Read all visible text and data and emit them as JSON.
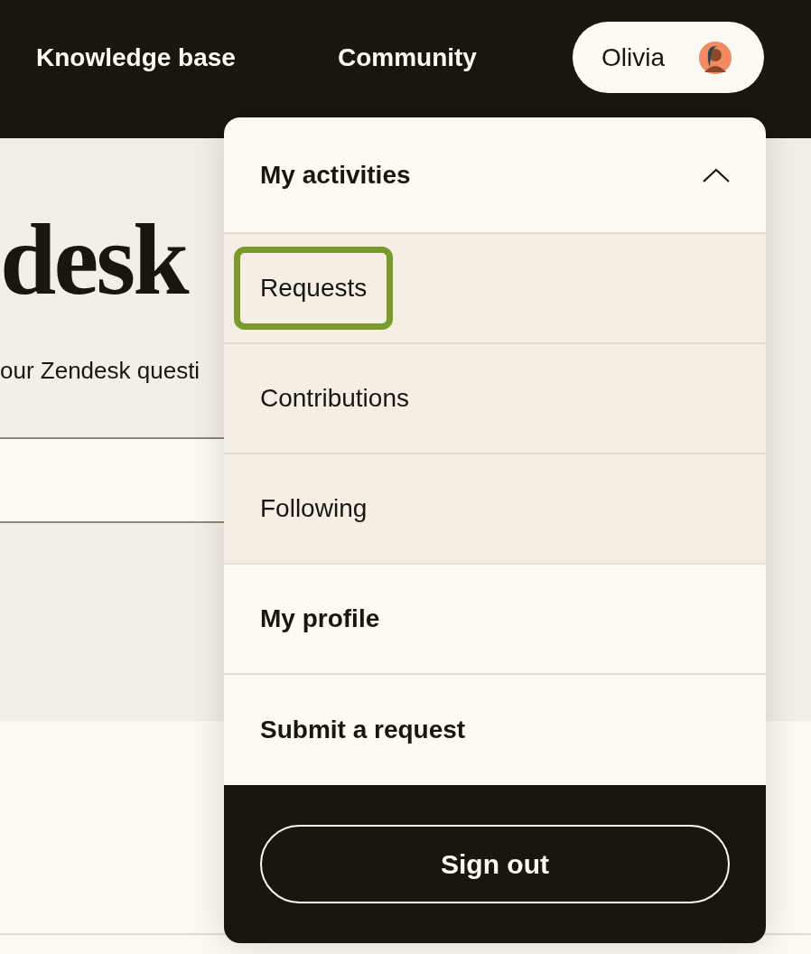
{
  "nav": [
    {
      "label": "Knowledge base"
    },
    {
      "label": "Community"
    }
  ],
  "user": {
    "name": "Olivia"
  },
  "hero": {
    "title": "desk",
    "subtitle": "our Zendesk questi"
  },
  "menu": {
    "items": [
      {
        "kind": "group",
        "label": "My activities",
        "expanded": true,
        "children": [
          {
            "label": "Requests",
            "focused": true
          },
          {
            "label": "Contributions",
            "focused": false
          },
          {
            "label": "Following",
            "focused": false
          }
        ]
      },
      {
        "kind": "link",
        "label": "My profile"
      },
      {
        "kind": "link",
        "label": "Submit a request"
      }
    ],
    "sign_out": "Sign out"
  }
}
